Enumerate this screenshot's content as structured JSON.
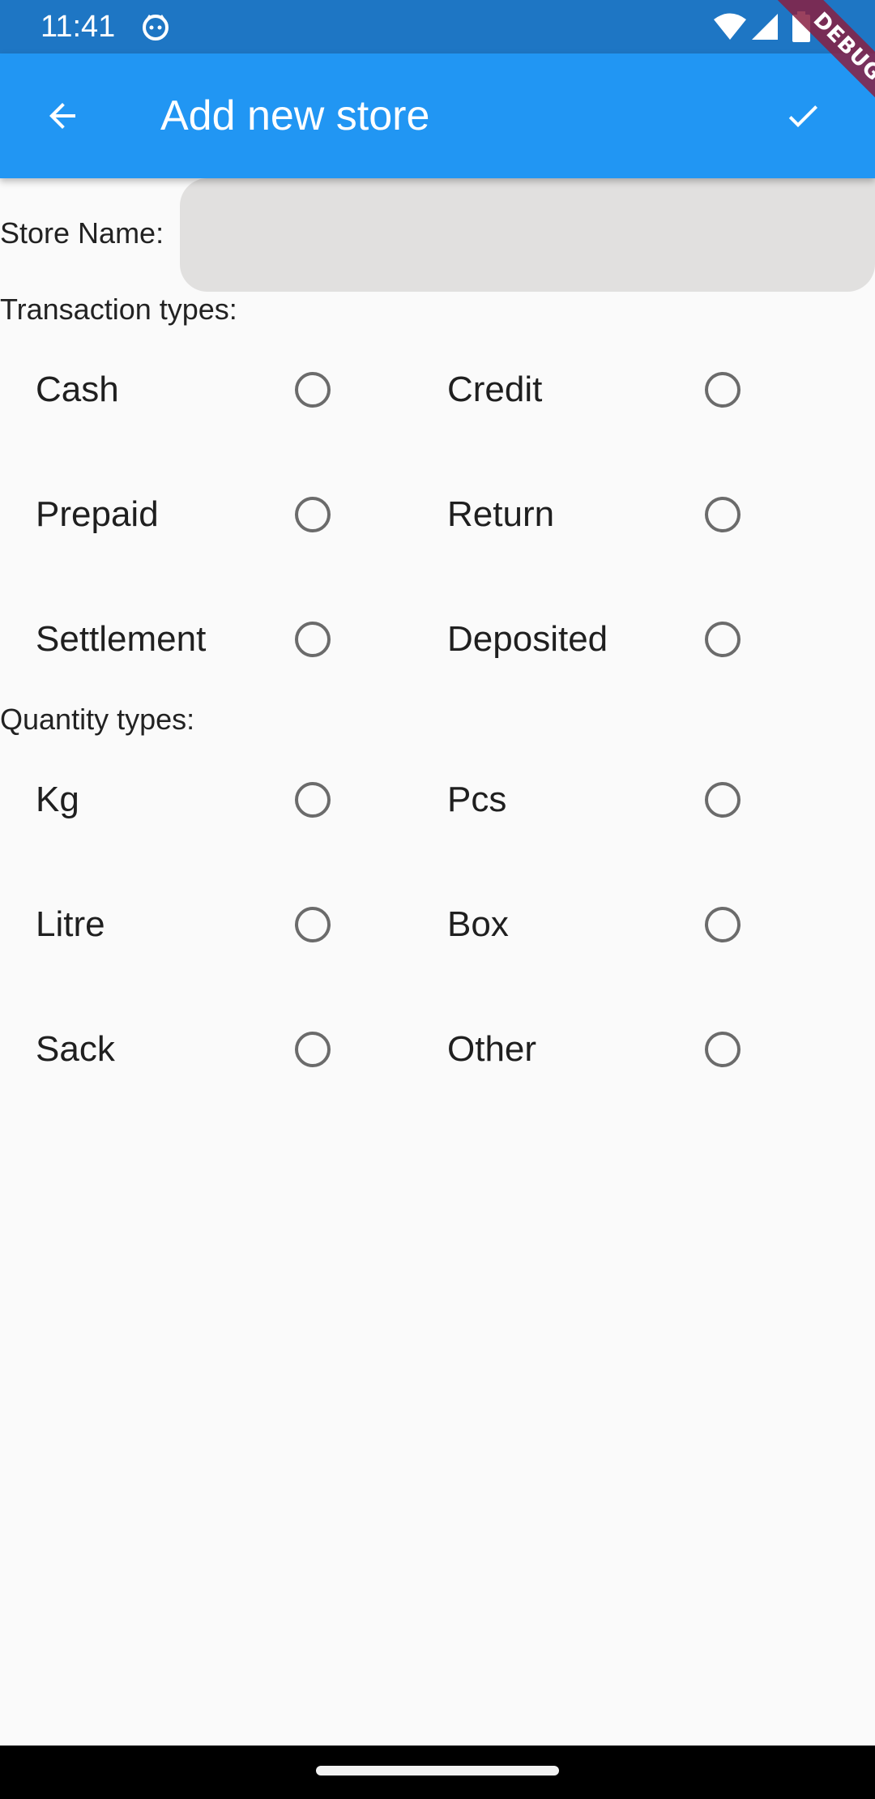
{
  "status_bar": {
    "time": "11:41",
    "icons": [
      "android-cat-icon",
      "wifi-icon",
      "cell-signal-icon",
      "battery-icon"
    ]
  },
  "app_bar": {
    "title": "Add new store",
    "back_icon": "arrow-back-icon",
    "confirm_icon": "check-icon",
    "color": "#2196f3"
  },
  "debug_banner": "DEBUG",
  "form": {
    "store_name_label": "Store Name:",
    "store_name_value": "",
    "transaction_types_label": "Transaction types:",
    "transaction_types": [
      {
        "label": "Cash",
        "selected": false
      },
      {
        "label": "Credit",
        "selected": false
      },
      {
        "label": "Prepaid",
        "selected": false
      },
      {
        "label": "Return",
        "selected": false
      },
      {
        "label": "Settlement",
        "selected": false
      },
      {
        "label": "Deposited",
        "selected": false
      }
    ],
    "quantity_types_label": "Quantity types:",
    "quantity_types": [
      {
        "label": "Kg",
        "selected": false
      },
      {
        "label": "Pcs",
        "selected": false
      },
      {
        "label": "Litre",
        "selected": false
      },
      {
        "label": "Box",
        "selected": false
      },
      {
        "label": "Sack",
        "selected": false
      },
      {
        "label": "Other",
        "selected": false
      }
    ]
  }
}
